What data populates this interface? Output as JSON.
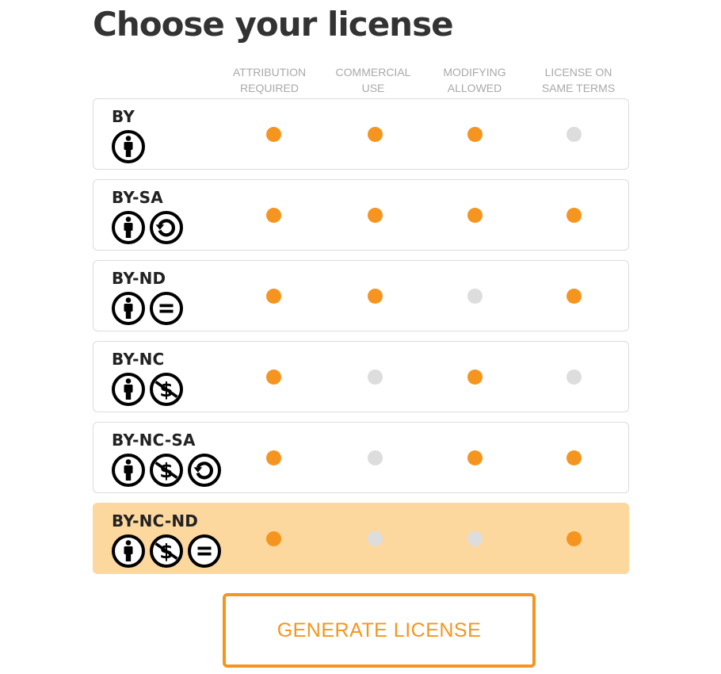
{
  "page": {
    "title": "Choose your license"
  },
  "columns": [
    {
      "label": "Attribution\nRequired"
    },
    {
      "label": "Commercial\nUse"
    },
    {
      "label": "Modifying\nAllowed"
    },
    {
      "label": "License on\nSame Terms"
    }
  ],
  "licenses": [
    {
      "name": "BY",
      "icons": [
        "by-icon"
      ],
      "features": [
        true,
        true,
        true,
        false
      ],
      "selected": false
    },
    {
      "name": "BY-SA",
      "icons": [
        "by-icon",
        "sa-icon"
      ],
      "features": [
        true,
        true,
        true,
        true
      ],
      "selected": false
    },
    {
      "name": "BY-ND",
      "icons": [
        "by-icon",
        "nd-icon"
      ],
      "features": [
        true,
        true,
        false,
        true
      ],
      "selected": false
    },
    {
      "name": "BY-NC",
      "icons": [
        "by-icon",
        "nc-icon"
      ],
      "features": [
        true,
        false,
        true,
        false
      ],
      "selected": false
    },
    {
      "name": "BY-NC-SA",
      "icons": [
        "by-icon",
        "nc-icon",
        "sa-icon"
      ],
      "features": [
        true,
        false,
        true,
        true
      ],
      "selected": false
    },
    {
      "name": "BY-NC-ND",
      "icons": [
        "by-icon",
        "nc-icon",
        "nd-icon"
      ],
      "features": [
        true,
        false,
        false,
        true
      ],
      "selected": true
    }
  ],
  "actions": {
    "generate_label": "GENERATE LICENSE"
  },
  "colors": {
    "accent": "#f5951f",
    "inactive_dot": "#dddddd",
    "selected_row": "#fdd89e",
    "title": "#333333",
    "header_text": "#a9a9a9"
  }
}
